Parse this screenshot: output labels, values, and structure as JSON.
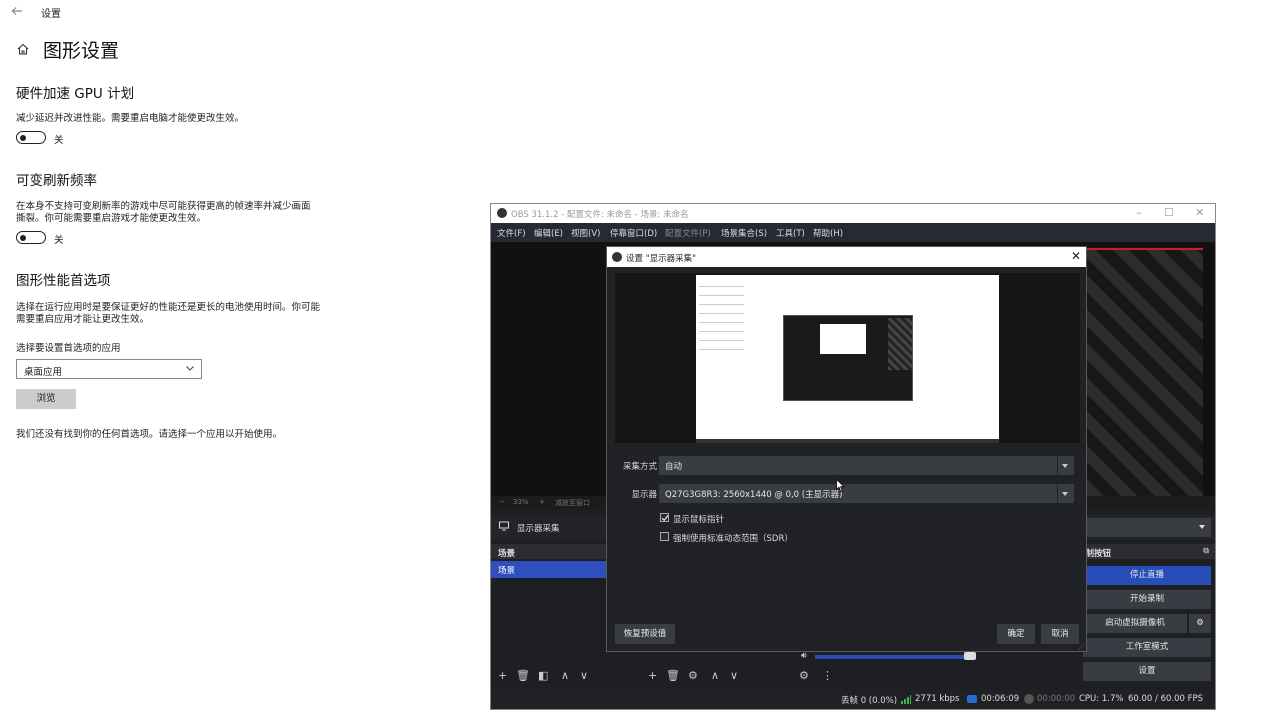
{
  "windows_settings": {
    "window_title": "设置",
    "page_title": "图形设置",
    "hardware_gpu": {
      "title": "硬件加速 GPU 计划",
      "desc": "减少延迟并改进性能。需要重启电脑才能使更改生效。",
      "toggle_label": "关"
    },
    "vrr": {
      "title": "可变刷新频率",
      "desc_line1": "在本身不支持可变刷新率的游戏中尽可能获得更高的帧速率并减少画面",
      "desc_line2": "撕裂。你可能需要重启游戏才能使更改生效。",
      "toggle_label": "关"
    },
    "perf_pref": {
      "title": "图形性能首选项",
      "desc_line1": "选择在运行应用时是要保证更好的性能还是更长的电池使用时间。你可能",
      "desc_line2": "需要重启应用才能让更改生效。",
      "select_label": "选择要设置首选项的应用",
      "select_value": "桌面应用",
      "browse_label": "浏览",
      "empty_msg": "我们还没有找到你的任何首选项。请选择一个应用以开始使用。"
    }
  },
  "obs": {
    "title": "OBS 31.1.2 - 配置文件: 未命名 - 场景: 未命名",
    "menu": [
      "文件(F)",
      "编辑(E)",
      "视图(V)",
      "停靠窗口(D)",
      "配置文件(P)",
      "场景集合(S)",
      "工具(T)",
      "帮助(H)"
    ],
    "zoom": "33%",
    "zoom_hint": "减放至窗口",
    "source_name": "显示器采集",
    "scenes_header": "场景",
    "scene_item": "场景",
    "controls_header": "控制按钮",
    "controls": {
      "stop_stream": "停止直播",
      "start_record": "开始录制",
      "virtual_cam": "启动虚拟摄像机",
      "studio_mode": "工作室模式",
      "settings": "设置"
    },
    "status": {
      "dropped": "丢帧 0 (0.0%)",
      "bitrate": "2771 kbps",
      "stream_time": "00:06:09",
      "rec_time": "00:00:00",
      "cpu": "CPU: 1.7%",
      "fps": "60.00 / 60.00 FPS"
    },
    "colors": {
      "accent": "#284cb8",
      "live_red": "#c0222b"
    }
  },
  "dialog": {
    "title": "设置 \"显示器采集\"",
    "capture_method_label": "采集方式",
    "capture_method_value": "自动",
    "display_label": "显示器",
    "display_value": "Q27G3G8R3: 2560x1440 @ 0,0 (主显示器)",
    "show_cursor_label": "显示鼠标指针",
    "show_cursor_checked": true,
    "force_sdr_label": "强制使用标准动态范围（SDR）",
    "force_sdr_checked": false,
    "restore_defaults": "恢复预设值",
    "ok": "确定",
    "cancel": "取消"
  }
}
